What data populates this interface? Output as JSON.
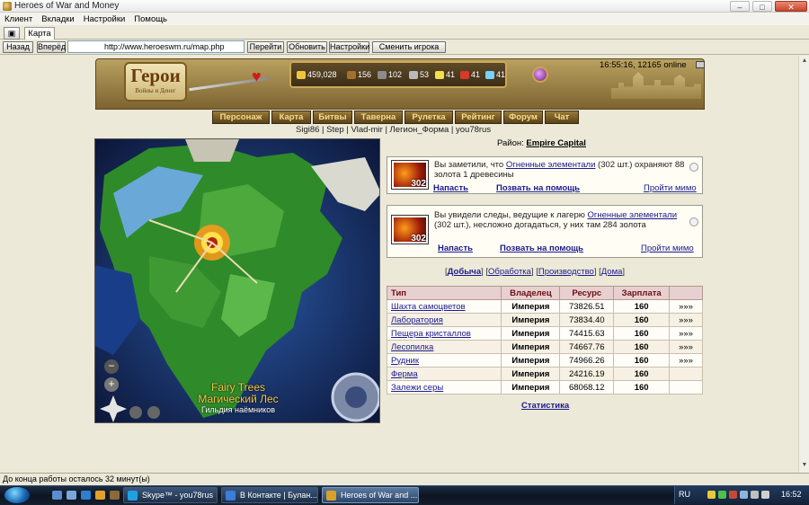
{
  "window": {
    "title": "Heroes of War and Money"
  },
  "menu": [
    "Клиент",
    "Вкладки",
    "Настройки",
    "Помощь"
  ],
  "tabs": [
    {
      "label": "Карта"
    }
  ],
  "nav": {
    "back": "Назад",
    "forward": "Вперёд",
    "url": "http://www.heroeswm.ru/map.php",
    "go": "Перейти",
    "refresh": "Обновить",
    "settings": "Настройки",
    "switch_player": "Сменить игрока"
  },
  "header": {
    "logo_title": "Герои",
    "logo_sub": "Войны и Денег",
    "resources": [
      "459,028",
      "156",
      "102",
      "53",
      "41",
      "41",
      "41"
    ],
    "resource_colors": [
      "#f0c53a",
      "#a5702a",
      "#8c8c8c",
      "#b9b9b9",
      "#f4e04a",
      "#d83a2a",
      "#7ad0ff"
    ],
    "clock": "16:55:16, 12165 online"
  },
  "game_menu": [
    "Персонаж",
    "Карта",
    "Битвы",
    "Таверна",
    "Рулетка",
    "Рейтинг",
    "Форум",
    "Чат"
  ],
  "players": "Sigi86 | Step | Vlad-mir | Легион_Форма | you78rus",
  "map": {
    "label1": "Fairy Trees",
    "label2": "Магический Лес",
    "label3": "Гильдия наёмников"
  },
  "district": {
    "label": "Район:",
    "name": "Empire Capital"
  },
  "events": [
    {
      "count": "302",
      "text_before": "Вы заметили, что ",
      "link": "Огненные элементали",
      "text_after": " (302 шт.) охраняют 88 золота 1 древесины",
      "attack": "Напасть",
      "call_help": "Позвать на помощь",
      "pass": "Пройти мимо"
    },
    {
      "count": "302",
      "text_before": "Вы увидели следы, ведущие к лагерю ",
      "link": "Огненные элементали",
      "text_after": " (302 шт.), несложно догадаться, у них там 284 золота",
      "attack": "Напасть",
      "call_help": "Позвать на помощь",
      "pass": "Пройти мимо"
    }
  ],
  "subnav": [
    "Добыча",
    "Обработка",
    "Производство",
    "Дома"
  ],
  "table": {
    "headers": [
      "Тип",
      "Владелец",
      "Ресурс",
      "Зарплата",
      ""
    ],
    "rows": [
      {
        "type": "Шахта самоцветов",
        "owner": "Империя",
        "resource": "73826.51",
        "salary": "160",
        "go": "»»»"
      },
      {
        "type": "Лаборатория",
        "owner": "Империя",
        "resource": "73834.40",
        "salary": "160",
        "go": "»»»"
      },
      {
        "type": "Пещера кристаллов",
        "owner": "Империя",
        "resource": "74415.63",
        "salary": "160",
        "go": "»»»"
      },
      {
        "type": "Лесопилка",
        "owner": "Империя",
        "resource": "74667.76",
        "salary": "160",
        "go": "»»»"
      },
      {
        "type": "Рудник",
        "owner": "Империя",
        "resource": "74966.26",
        "salary": "160",
        "go": "»»»"
      },
      {
        "type": "Ферма",
        "owner": "Империя",
        "resource": "24216.19",
        "salary": "160",
        "go": ""
      },
      {
        "type": "Залежи серы",
        "owner": "Империя",
        "resource": "68068.12",
        "salary": "160",
        "go": ""
      }
    ]
  },
  "stats_link": "Статистика",
  "status": "До конца работы осталось 32 минут(ы)",
  "taskbar": {
    "items": [
      "Skype™ - you78rus",
      "В Контакте | Булан...",
      "Heroes of War and ..."
    ],
    "lang": "RU",
    "time": "16:52"
  }
}
